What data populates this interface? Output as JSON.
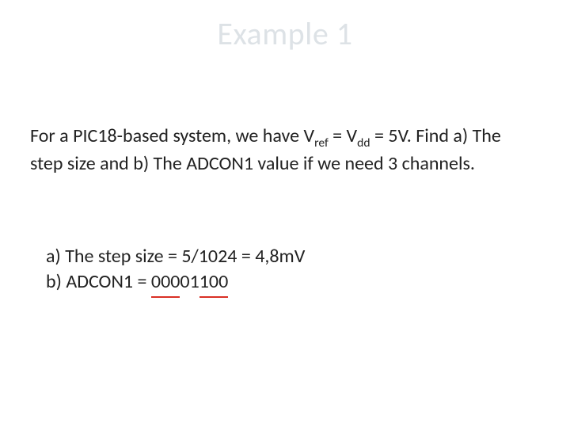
{
  "title": "Example 1",
  "question": {
    "prefix": "For a PIC18-based system, we have V",
    "sub1": "ref",
    "mid1": " = V",
    "sub2": "dd",
    "mid2": " = 5V. Find a) The step size and b) The ADCON1 value if we need  3 channels."
  },
  "answer": {
    "a": "a) The step size = 5/1024 = 4,8mV",
    "b_prefix": "b) ADCON1 = ",
    "b_underlined1": "000",
    "b_mid": "01",
    "b_underlined2": "100"
  }
}
